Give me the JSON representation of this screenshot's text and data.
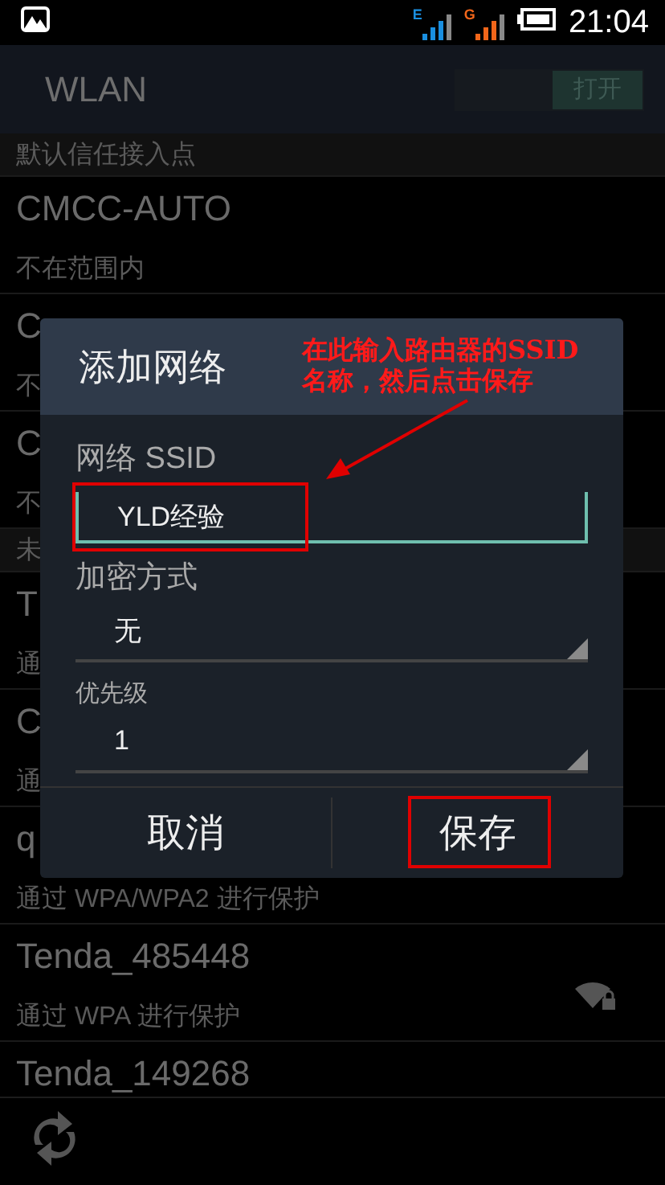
{
  "status_bar": {
    "signals": [
      {
        "label": "E",
        "color": "#1a8fe0"
      },
      {
        "label": "G",
        "color": "#f2661a"
      }
    ],
    "time": "21:04"
  },
  "action_bar": {
    "title": "WLAN",
    "toggle": {
      "label": "打开",
      "on": true
    }
  },
  "sections": [
    {
      "header": "默认信任接入点",
      "items": [
        {
          "name": "CMCC-AUTO",
          "subtitle": "不在范围内",
          "wifi_icon": false
        },
        {
          "name": "C",
          "subtitle": "不",
          "wifi_icon": false
        },
        {
          "name": "C",
          "subtitle": "不",
          "wifi_icon": false
        }
      ]
    },
    {
      "header": "未",
      "items": [
        {
          "name": "T",
          "subtitle": "通",
          "wifi_icon": false
        },
        {
          "name": "C",
          "subtitle": "通",
          "wifi_icon": false
        },
        {
          "name": "q",
          "subtitle": "通过 WPA/WPA2 进行保护",
          "wifi_icon": false
        },
        {
          "name": "Tenda_485448",
          "subtitle": "通过 WPA 进行保护",
          "wifi_icon": true
        },
        {
          "name": "Tenda_149268",
          "wifi_icon": false
        }
      ]
    }
  ],
  "dialog": {
    "title": "添加网络",
    "fields": [
      {
        "kind": "text",
        "label": "网络 SSID",
        "value": "YLD经验",
        "focused": true
      },
      {
        "kind": "select",
        "label": "加密方式",
        "value": "无"
      },
      {
        "kind": "select",
        "label": "优先级",
        "value": "1",
        "small": true
      }
    ],
    "buttons": [
      "取消",
      "保存"
    ]
  },
  "annotation": {
    "note_lines": [
      "在此输入路由器的SSID",
      "名称，然后点击保存"
    ]
  }
}
